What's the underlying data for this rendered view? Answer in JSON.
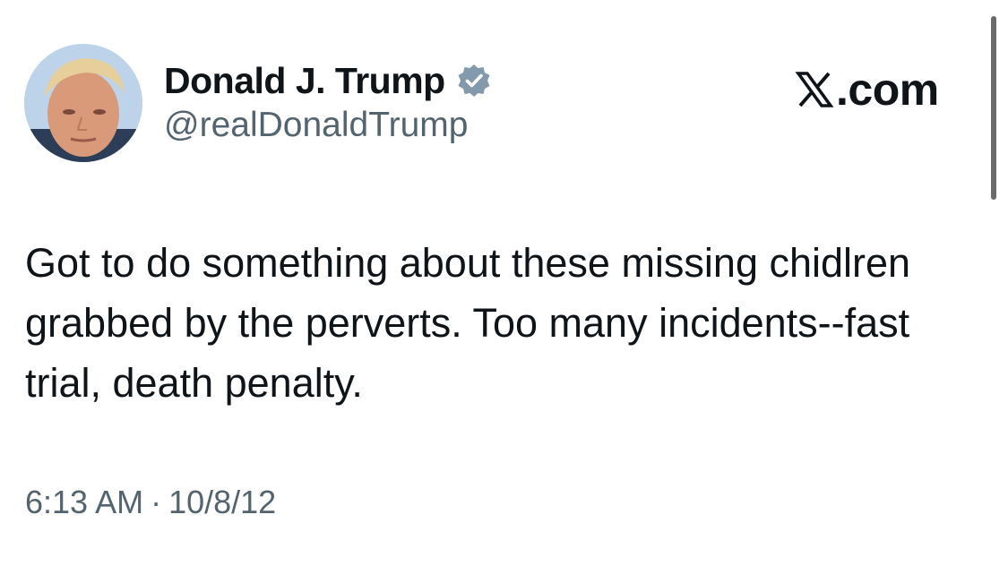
{
  "author": {
    "display_name": "Donald J. Trump",
    "handle": "@realDonaldTrump",
    "verified": true,
    "avatar_icon": "profile-photo"
  },
  "brand": {
    "label": ".com",
    "logo_icon": "x-logo-icon"
  },
  "tweet": {
    "text": "Got to do something about these missing chidlren grabbed by the perverts. Too many incidents--fast trial, death penalty.",
    "time": "6:13 AM",
    "separator": "·",
    "date": "10/8/12"
  },
  "colors": {
    "text_primary": "#0f1419",
    "text_secondary": "#536471",
    "verified_badge": "#829aab",
    "background": "#ffffff"
  }
}
